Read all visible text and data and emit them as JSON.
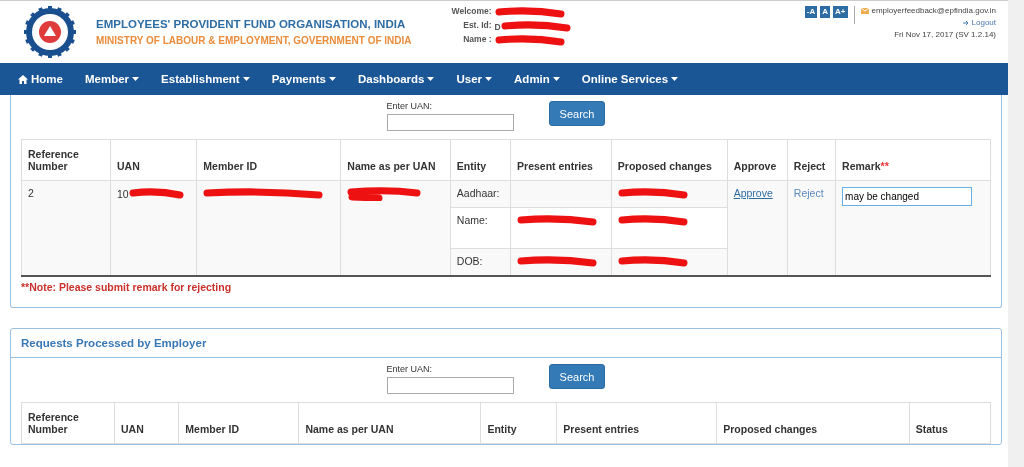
{
  "header": {
    "org_name": "EMPLOYEES' PROVIDENT FUND ORGANISATION, INDIA",
    "ministry": "MINISTRY OF LABOUR & EMPLOYMENT, GOVERNMENT OF INDIA",
    "user_info": [
      {
        "label": "Welcome:",
        "redacted": true
      },
      {
        "label": "Est. Id:",
        "value": "D",
        "redacted": true
      },
      {
        "label": "Name :",
        "redacted": true
      }
    ],
    "font_buttons": [
      "-A",
      "A",
      "A+"
    ],
    "email": "employerfeedback@epfindia.gov.in",
    "logout": "Logout",
    "date": "Fri Nov 17, 2017 (SV 1.2.14)"
  },
  "nav": [
    {
      "label": "Home",
      "kind": "home"
    },
    {
      "label": "Member",
      "kind": "dropdown"
    },
    {
      "label": "Establishment",
      "kind": "dropdown"
    },
    {
      "label": "Payments",
      "kind": "dropdown"
    },
    {
      "label": "Dashboards",
      "kind": "dropdown"
    },
    {
      "label": "User",
      "kind": "dropdown"
    },
    {
      "label": "Admin",
      "kind": "dropdown"
    },
    {
      "label": "Online Services",
      "kind": "dropdown"
    }
  ],
  "pending": {
    "search_label": "Enter UAN:",
    "search_button": "Search",
    "columns": [
      "Reference Number",
      "UAN",
      "Member ID",
      "Name as per UAN",
      "Entity",
      "Present entries",
      "Proposed changes",
      "Approve",
      "Reject",
      "Remark"
    ],
    "required_mark": "**",
    "row": {
      "reference": "2",
      "uan": {
        "value": "10",
        "redacted": true
      },
      "member_id": {
        "redacted": true
      },
      "name": {
        "redacted": true
      },
      "entities": [
        {
          "entity": "Aadhaar:",
          "present_redacted": false,
          "proposed_redacted": true
        },
        {
          "entity": "Name:",
          "present_redacted": true,
          "proposed_redacted": true
        },
        {
          "entity": "DOB:",
          "present_redacted": true,
          "proposed_redacted": true
        }
      ],
      "approve": "Approve",
      "reject": "Reject",
      "remark": "may be changed"
    },
    "note": "**Note: Please submit remark for rejecting"
  },
  "processed": {
    "title": "Requests Processed by Employer",
    "search_label": "Enter UAN:",
    "search_button": "Search",
    "columns": [
      "Reference Number",
      "UAN",
      "Member ID",
      "Name as per UAN",
      "Entity",
      "Present entries",
      "Proposed changes",
      "Status"
    ]
  }
}
